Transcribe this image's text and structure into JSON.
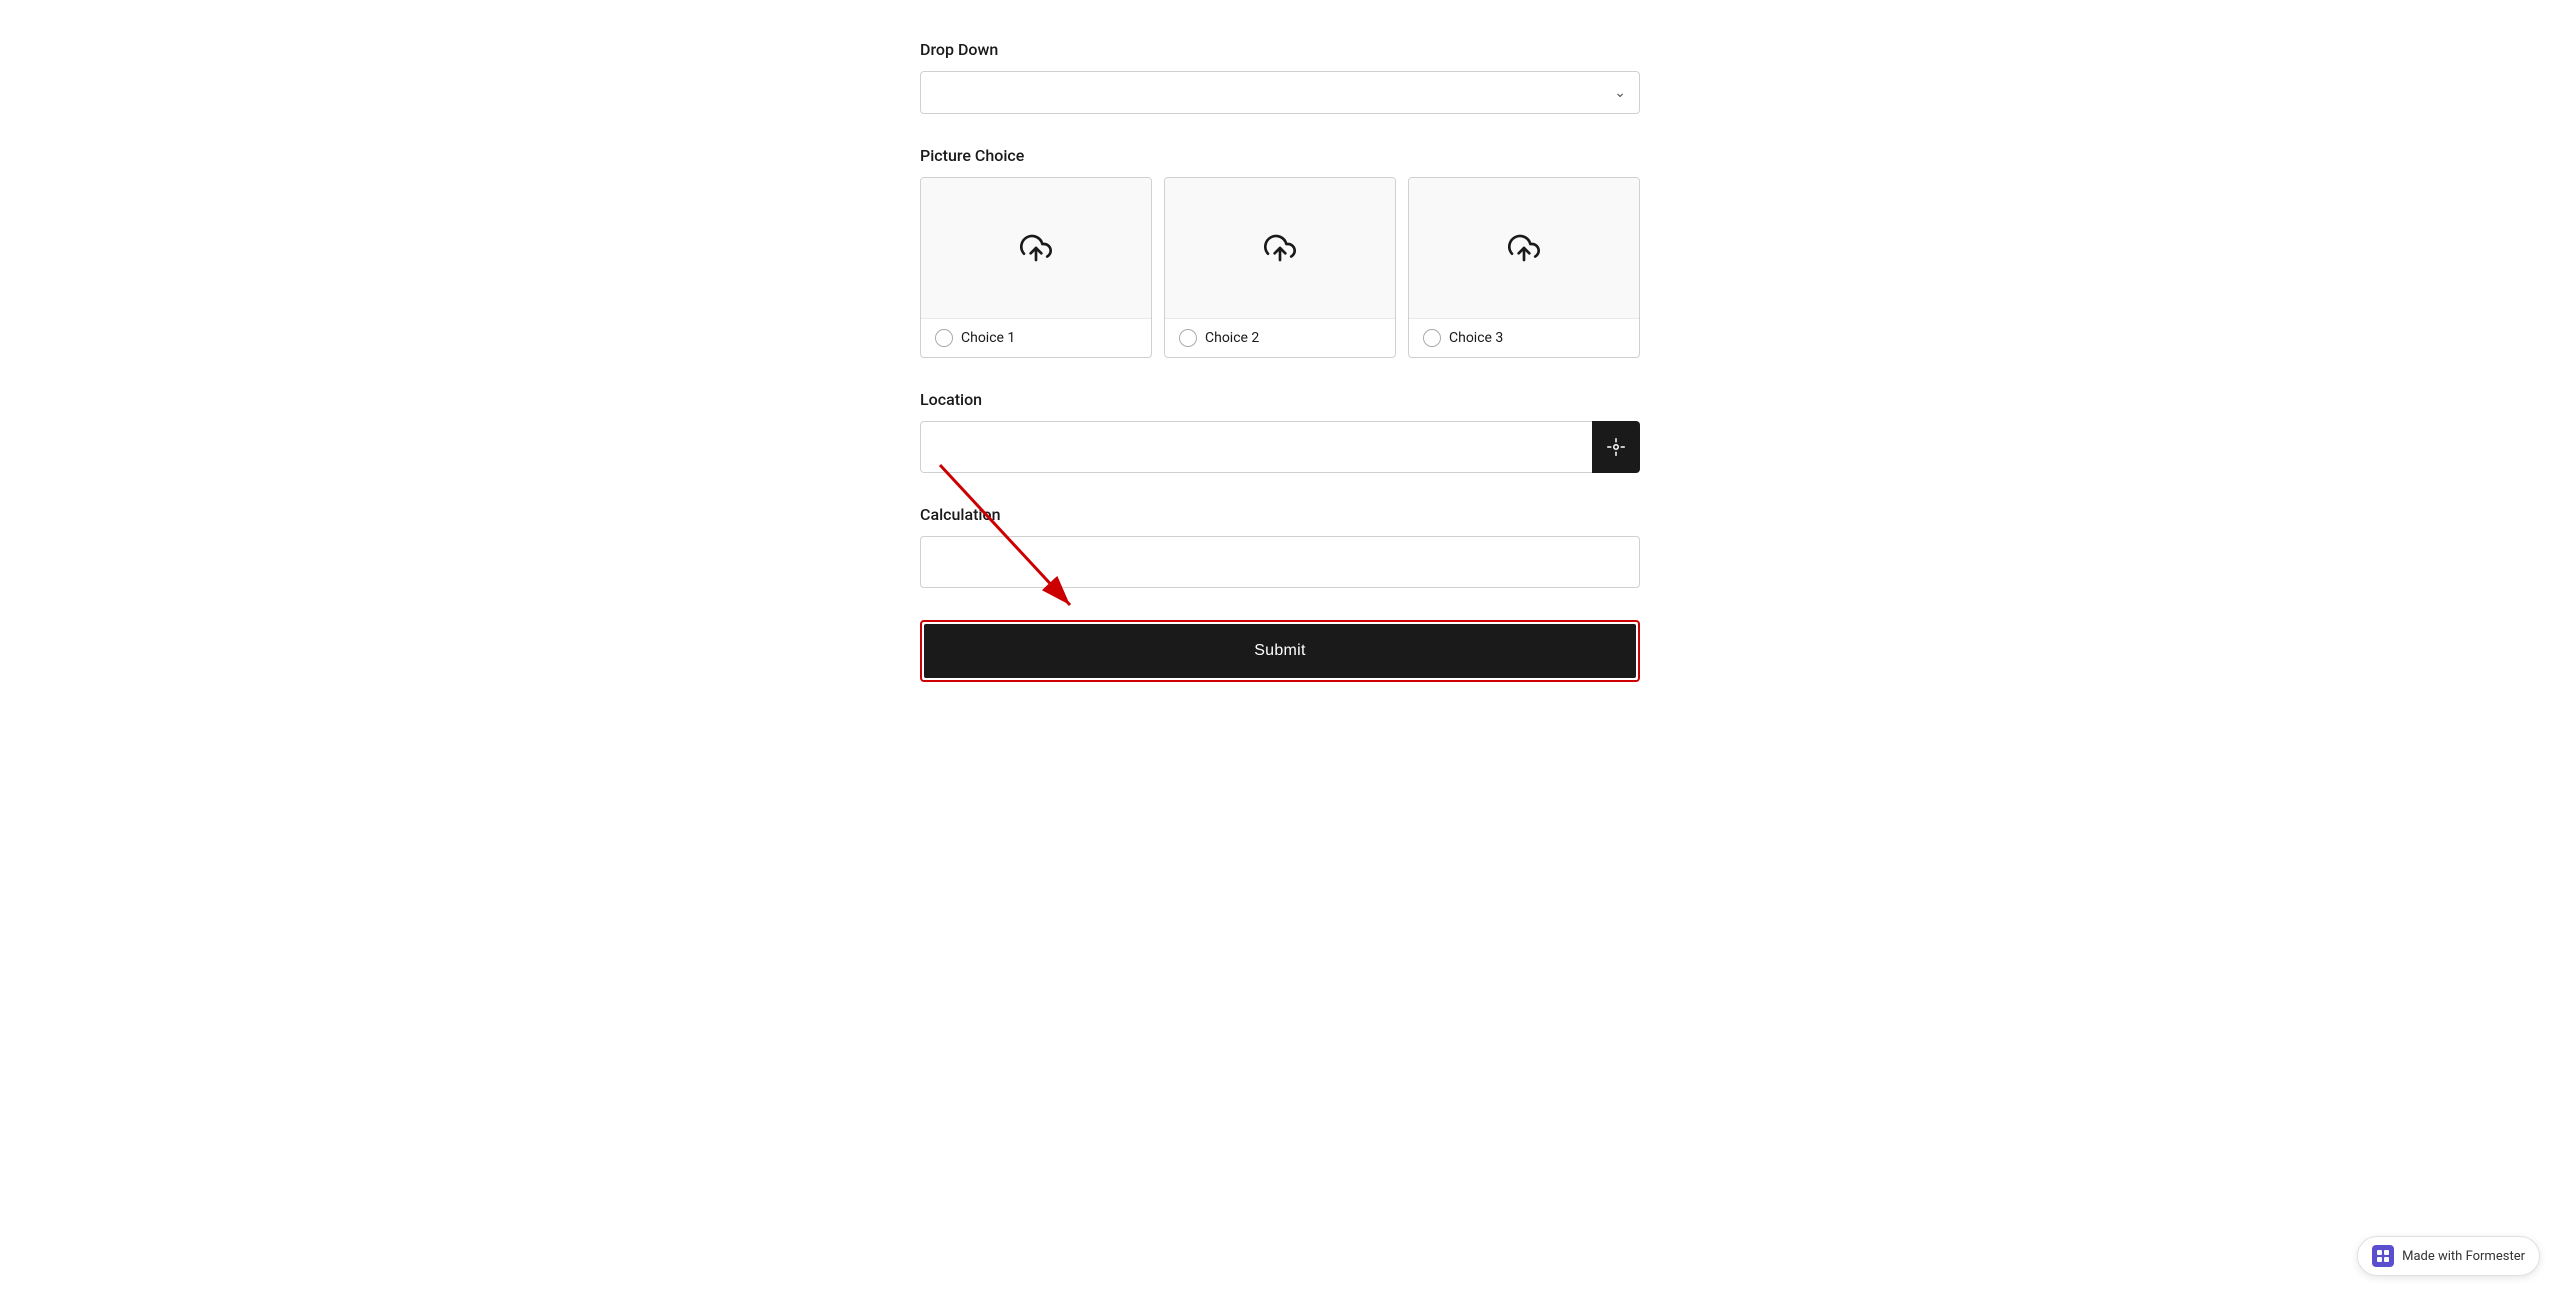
{
  "form": {
    "dropdown": {
      "label": "Drop Down",
      "placeholder": "",
      "chevron": "∨"
    },
    "picture_choice": {
      "label": "Picture Choice",
      "choices": [
        {
          "id": 1,
          "label": "Choice 1"
        },
        {
          "id": 2,
          "label": "Choice 2"
        },
        {
          "id": 3,
          "label": "Choice 3"
        }
      ]
    },
    "location": {
      "label": "Location"
    },
    "calculation": {
      "label": "Calculation"
    },
    "submit": {
      "label": "Submit"
    }
  },
  "badge": {
    "text": "Made with Formester"
  },
  "colors": {
    "accent_red": "#cc0000",
    "dark": "#1a1a1a",
    "purple": "#5b4fcf"
  }
}
